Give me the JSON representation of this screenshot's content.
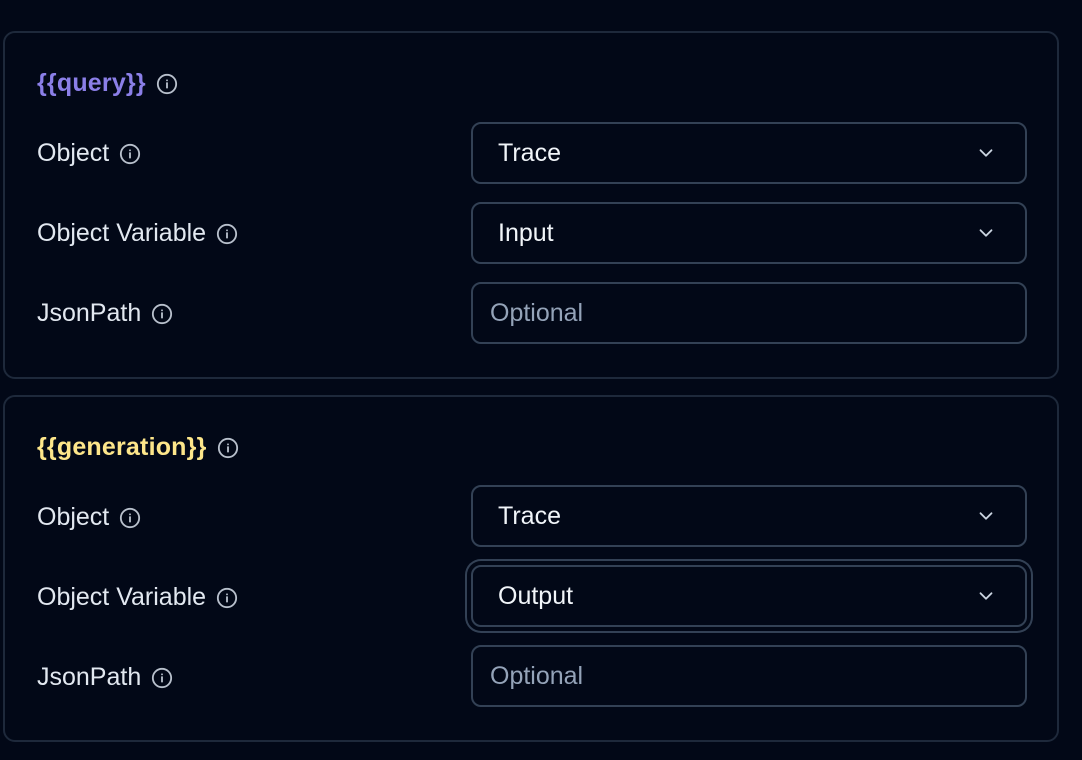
{
  "mappings": [
    {
      "variable": "{{query}}",
      "variable_color": "#8b7fe8",
      "object_label": "Object",
      "object_value": "Trace",
      "variable_label": "Object Variable",
      "variable_value": "Input",
      "jsonpath_label": "JsonPath",
      "jsonpath_value": "",
      "jsonpath_placeholder": "Optional"
    },
    {
      "variable": "{{generation}}",
      "variable_color": "#fde68a",
      "object_label": "Object",
      "object_value": "Trace",
      "variable_label": "Object Variable",
      "variable_value": "Output",
      "jsonpath_label": "JsonPath",
      "jsonpath_value": "",
      "jsonpath_placeholder": "Optional"
    }
  ],
  "icons": {
    "info": "info-icon",
    "dropdown": "chevron-down-icon"
  }
}
